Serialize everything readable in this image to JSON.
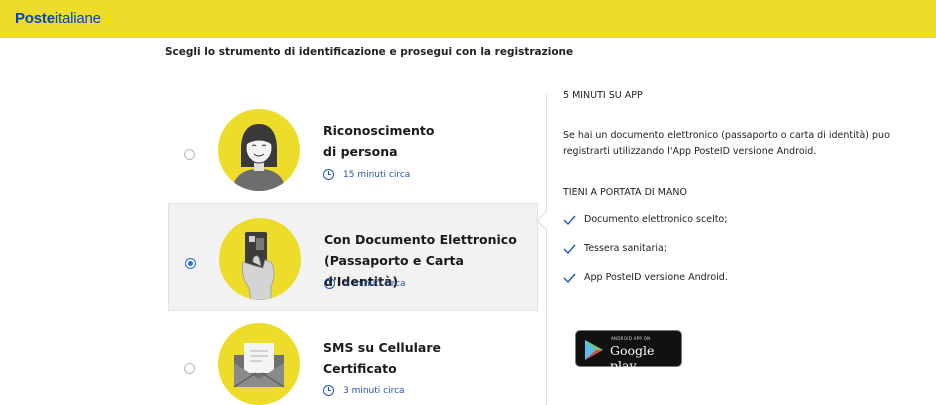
{
  "header": {
    "logo_bold": "Poste",
    "logo_light": "italiane",
    "bg_color": "#eedc2b",
    "logo_color": "#0047bb"
  },
  "instruction": "Scegli lo strumento di identificazione e prosegui con la registrazione",
  "options": [
    {
      "title_line1": "Riconoscimento",
      "title_line2": "di persona",
      "time": "15 minuti circa",
      "selected": false,
      "icon": "person-icon"
    },
    {
      "title_line1": "Con Documento Elettronico",
      "title_line2": "(Passaporto e Carta d'Identità)",
      "time": "5 minuti circa",
      "selected": true,
      "icon": "id-card-hand-icon"
    },
    {
      "title_line1": "SMS su Cellulare",
      "title_line2": "Certificato",
      "time": "3 minuti circa",
      "selected": false,
      "icon": "envelope-icon"
    }
  ],
  "panel": {
    "heading": "5 MINUTI SU APP",
    "text_line1": "Se hai un documento elettronico (passaporto o carta di identità) puo",
    "text_line2": "registrarti utilizzando l'App PosteID versione Android.",
    "checklist_heading": "TIENI A PORTATA DI MANO",
    "checklist": [
      "Documento elettronico scelto;",
      "Tessera sanitaria;",
      "App PosteID versione Android."
    ],
    "store_badge_small": "ANDROID APP ON",
    "store_badge_big": "Google play"
  },
  "colors": {
    "accent_yellow": "#eedc2b",
    "link_blue": "#2456a8",
    "radio_blue": "#2f6fd8"
  }
}
